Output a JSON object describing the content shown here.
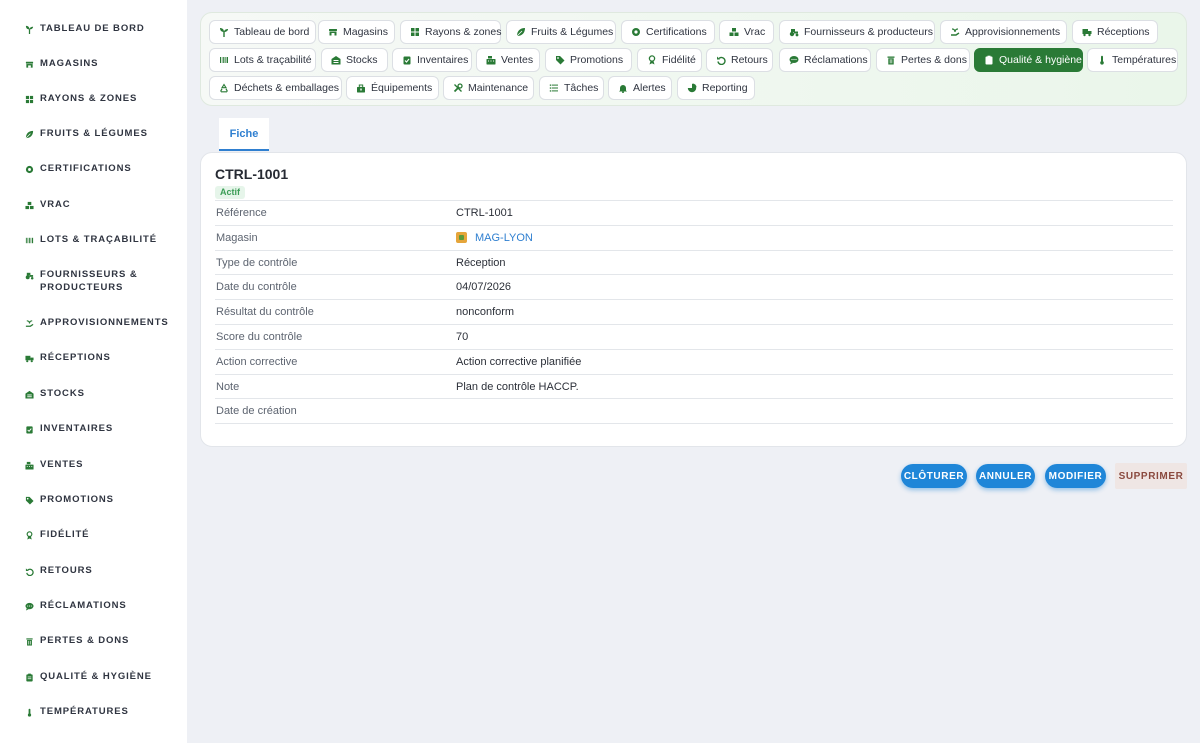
{
  "sidebar": {
    "items": [
      {
        "label": "Tableau de bord",
        "icon": "seedling-icon"
      },
      {
        "label": "Magasins",
        "icon": "store-icon"
      },
      {
        "label": "Rayons & zones",
        "icon": "grid-icon"
      },
      {
        "label": "Fruits & Légumes",
        "icon": "leaf-icon"
      },
      {
        "label": "Certifications",
        "icon": "certificate-icon"
      },
      {
        "label": "Vrac",
        "icon": "boxes-icon"
      },
      {
        "label": "Lots & traçabilité",
        "icon": "barcode-icon"
      },
      {
        "label": "Fournisseurs & producteurs",
        "icon": "tractor-icon"
      },
      {
        "label": "Approvisionnements",
        "icon": "hand-plant-icon"
      },
      {
        "label": "Réceptions",
        "icon": "truck-icon"
      },
      {
        "label": "Stocks",
        "icon": "warehouse-icon"
      },
      {
        "label": "Inventaires",
        "icon": "clipboard-check-icon"
      },
      {
        "label": "Ventes",
        "icon": "cash-register-icon"
      },
      {
        "label": "Promotions",
        "icon": "tag-icon"
      },
      {
        "label": "Fidélité",
        "icon": "award-icon"
      },
      {
        "label": "Retours",
        "icon": "undo-icon"
      },
      {
        "label": "Réclamations",
        "icon": "comment-icon"
      },
      {
        "label": "Pertes & dons",
        "icon": "trash-icon"
      },
      {
        "label": "Qualité & hygiène",
        "icon": "clipboard-icon"
      },
      {
        "label": "Températures",
        "icon": "thermometer-icon"
      }
    ]
  },
  "tabs": [
    {
      "label": "Tableau de bord",
      "icon": "seedling-icon"
    },
    {
      "label": "Magasins",
      "icon": "store-icon"
    },
    {
      "label": "Rayons & zones",
      "icon": "grid-icon"
    },
    {
      "label": "Fruits & Légumes",
      "icon": "leaf-icon"
    },
    {
      "label": "Certifications",
      "icon": "certificate-icon"
    },
    {
      "label": "Vrac",
      "icon": "boxes-icon"
    },
    {
      "label": "Fournisseurs & producteurs",
      "icon": "tractor-icon"
    },
    {
      "label": "Approvisionnements",
      "icon": "hand-plant-icon"
    },
    {
      "label": "Réceptions",
      "icon": "truck-icon"
    },
    {
      "label": "Lots & traçabilité",
      "icon": "barcode-icon"
    },
    {
      "label": "Stocks",
      "icon": "warehouse-icon"
    },
    {
      "label": "Inventaires",
      "icon": "clipboard-check-icon"
    },
    {
      "label": "Ventes",
      "icon": "cash-register-icon"
    },
    {
      "label": "Promotions",
      "icon": "tag-icon"
    },
    {
      "label": "Fidélité",
      "icon": "award-icon"
    },
    {
      "label": "Retours",
      "icon": "undo-icon"
    },
    {
      "label": "Réclamations",
      "icon": "comment-icon"
    },
    {
      "label": "Pertes & dons",
      "icon": "trash-icon"
    },
    {
      "label": "Qualité & hygiène",
      "icon": "clipboard-icon",
      "active": true
    },
    {
      "label": "Températures",
      "icon": "thermometer-icon"
    },
    {
      "label": "Déchets & emballages",
      "icon": "recycle-icon"
    },
    {
      "label": "Équipements",
      "icon": "tools-icon"
    },
    {
      "label": "Maintenance",
      "icon": "wrench-icon"
    },
    {
      "label": "Tâches",
      "icon": "list-icon"
    },
    {
      "label": "Alertes",
      "icon": "bell-icon"
    },
    {
      "label": "Reporting",
      "icon": "pie-chart-icon"
    }
  ],
  "subtab": {
    "label": "Fiche"
  },
  "record": {
    "title": "CTRL-1001",
    "status": "Actif",
    "fields": [
      {
        "label": "Référence",
        "value": "CTRL-1001"
      },
      {
        "label": "Magasin",
        "value": "MAG-LYON",
        "link": true
      },
      {
        "label": "Type de contrôle",
        "value": "Réception"
      },
      {
        "label": "Date du contrôle",
        "value": "04/07/2026"
      },
      {
        "label": "Résultat du contrôle",
        "value": "nonconform"
      },
      {
        "label": "Score du contrôle",
        "value": "70"
      },
      {
        "label": "Action corrective",
        "value": "Action corrective planifiée"
      },
      {
        "label": "Note",
        "value": "Plan de contrôle HACCP."
      },
      {
        "label": "Date de création",
        "value": ""
      }
    ]
  },
  "actions": {
    "close": "Clôturer",
    "cancel": "Annuler",
    "edit": "Modifier",
    "delete": "Supprimer"
  },
  "colors": {
    "accent_green": "#2a7a36",
    "primary_blue": "#1f86d8",
    "status_green": "#3c9d57",
    "icon_green": "#2a7a36"
  }
}
